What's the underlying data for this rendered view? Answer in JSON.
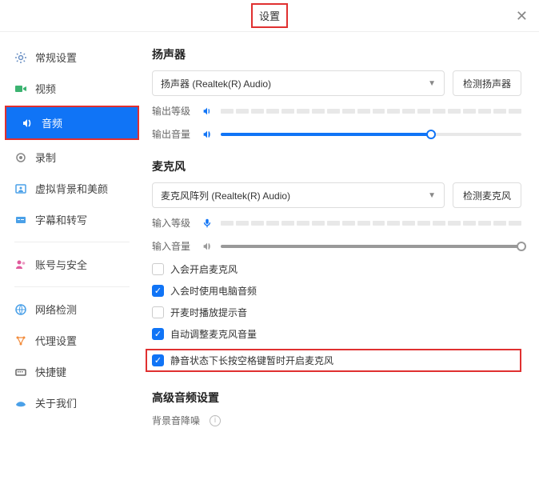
{
  "header": {
    "title": "设置"
  },
  "sidebar": {
    "items": [
      {
        "label": "常规设置",
        "icon": "gear-icon",
        "color": "#6b90c4"
      },
      {
        "label": "视频",
        "icon": "video-icon",
        "color": "#3cb371"
      },
      {
        "label": "音频",
        "icon": "audio-icon",
        "color": "#ffffff",
        "active": true
      },
      {
        "label": "录制",
        "icon": "record-icon",
        "color": "#888"
      },
      {
        "label": "虚拟背景和美颜",
        "icon": "virtual-bg-icon",
        "color": "#4aa0e8"
      },
      {
        "label": "字幕和转写",
        "icon": "caption-icon",
        "color": "#4aa0e8"
      },
      {
        "label": "账号与安全",
        "icon": "account-icon",
        "color": "#e05a9c"
      },
      {
        "label": "网络检测",
        "icon": "network-icon",
        "color": "#4aa0e8"
      },
      {
        "label": "代理设置",
        "icon": "proxy-icon",
        "color": "#f28c3c"
      },
      {
        "label": "快捷键",
        "icon": "shortcut-icon",
        "color": "#666"
      },
      {
        "label": "关于我们",
        "icon": "about-icon",
        "color": "#4aa0e8"
      }
    ],
    "divider_after": [
      5,
      6
    ]
  },
  "speaker": {
    "title": "扬声器",
    "selected": "扬声器 (Realtek(R) Audio)",
    "test_btn": "检测扬声器",
    "output_level_label": "输出等级",
    "output_volume_label": "输出音量",
    "volume_percent": 70
  },
  "mic": {
    "title": "麦克风",
    "selected": "麦克风阵列 (Realtek(R) Audio)",
    "test_btn": "检测麦克风",
    "input_level_label": "输入等级",
    "input_volume_label": "输入音量",
    "volume_percent": 100
  },
  "checks": {
    "c1": {
      "label": "入会开启麦克风",
      "checked": false
    },
    "c2": {
      "label": "入会时使用电脑音频",
      "checked": true
    },
    "c3": {
      "label": "开麦时播放提示音",
      "checked": false
    },
    "c4": {
      "label": "自动调整麦克风音量",
      "checked": true
    },
    "c5": {
      "label": "静音状态下长按空格键暂时开启麦克风",
      "checked": true
    }
  },
  "advanced": {
    "title": "高级音频设置",
    "bg_noise_label": "背景音降噪"
  }
}
